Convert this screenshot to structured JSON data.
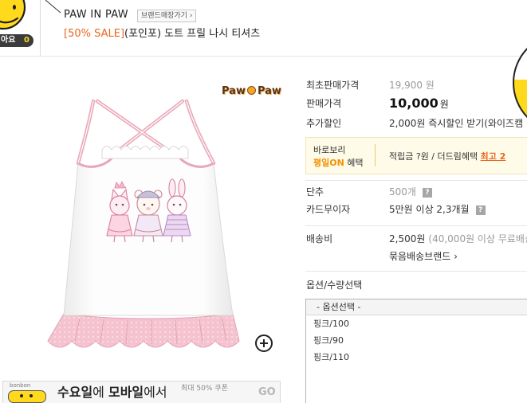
{
  "colors": {
    "accent_orange": "#e8671c",
    "promo_orange": "#f29000",
    "mascot_yellow": "#ffd91c",
    "promo_bg": "#fffbe9"
  },
  "icons": {
    "mascot": "smiley-mascot-icon",
    "zoom": "zoom-in-icon",
    "help": "help-icon",
    "chevron": "chevron-right-icon"
  },
  "mascot": {
    "like_label": "아요",
    "like_count": "0"
  },
  "header": {
    "brand": "PAW IN PAW",
    "brand_shop_button": "브랜드매장가기 ›",
    "sale_tag": "[50% SALE]",
    "product_name": "(포인포) 도트 프릴 나시 티셔츠"
  },
  "product_image": {
    "logo_left": "Paw",
    "logo_right": "Paw"
  },
  "banner": {
    "logo_text": "bonbon",
    "headline": [
      {
        "text": "수요일",
        "bold": true
      },
      {
        "text": "에 ",
        "bold": false
      },
      {
        "text": "모바일",
        "bold": true
      },
      {
        "text": "에서",
        "bold": false
      }
    ],
    "coupon": "최대 50% 쿠폰",
    "go": "GO"
  },
  "info": {
    "help_glyph": "?",
    "original_price": {
      "label": "최초판매가격",
      "value": "19,900 원"
    },
    "sale_price": {
      "label": "판매가격",
      "amount": "10,000",
      "unit": "원"
    },
    "extra_discount": {
      "label": "추가할인",
      "value": "2,000원 즉시할인 받기(와이즈캠"
    },
    "promo": {
      "line1": "바로보리",
      "highlight": "평일ON",
      "line2_suffix": " 혜택",
      "points": "적립금 ?원 / 더드림혜택 ",
      "best": "최고 2"
    },
    "stock": {
      "label": "단추",
      "value": "500개"
    },
    "card": {
      "label": "카드무이자",
      "value": "5만원 이상 2,3개월"
    },
    "shipping": {
      "label": "배송비",
      "fee": "2,500원",
      "note": "(40,000원 이상 무료배송",
      "bundle_link": "묶음배송브랜드 ›"
    },
    "options": {
      "label": "옵션/수량선택",
      "placeholder": "- 옵션선택 -",
      "items": [
        "핑크/100",
        "핑크/90",
        "핑크/110"
      ]
    }
  }
}
